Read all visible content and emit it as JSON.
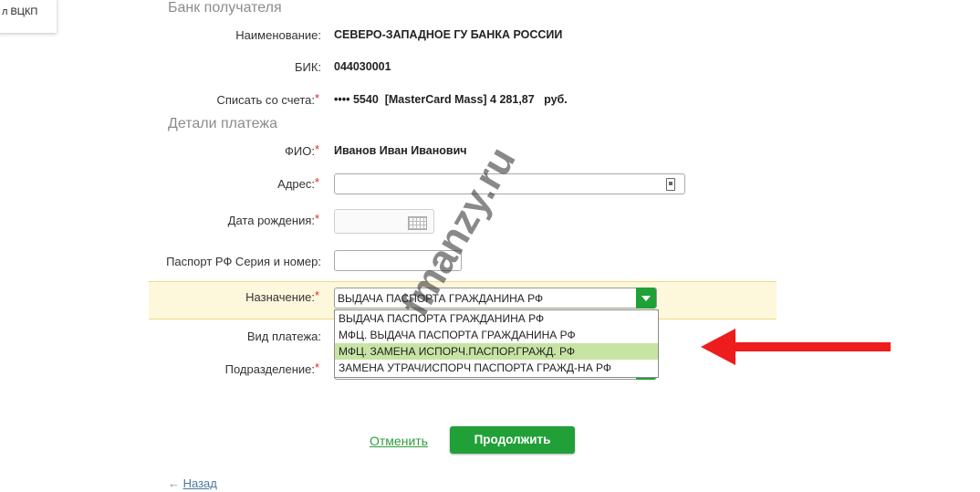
{
  "side_card": {
    "text": "л ВЦКП"
  },
  "bank_section": {
    "title": "Банк получателя",
    "name_label": "Наименование:",
    "name_value": "СЕВЕРО-ЗАПАДНОЕ ГУ БАНКА РОССИИ",
    "bik_label": "БИК:",
    "bik_value": "044030001",
    "account_label": "Списать со счета:",
    "account_value": "•••• 5540  [MasterCard Mass] 4 281,87   руб."
  },
  "payment_section": {
    "title": "Детали платежа",
    "fio_label": "ФИО:",
    "fio_value": "Иванов Иван Иванович",
    "address_label": "Адрес:",
    "address_value": "",
    "birthdate_label": "Дата рождения:",
    "birthdate_value": "",
    "passport_label": "Паспорт РФ Серия и номер:",
    "passport_value": "",
    "purpose_label": "Назначение:",
    "purpose_selected": "ВЫДАЧА ПАСПОРТА ГРАЖДАНИНА РФ",
    "purpose_options": [
      "ВЫДАЧА ПАСПОРТА ГРАЖДАНИНА РФ",
      "МФЦ. ВЫДАЧА ПАСПОРТА ГРАЖДАНИНА РФ",
      "МФЦ. ЗАМЕНА ИСПОРЧ.ПАСПОР.ГРАЖД. РФ",
      "ЗАМЕНА УТРАЧ/ИСПОРЧ ПАСПОРТА ГРАЖД-НА РФ"
    ],
    "purpose_highlighted_index": 2,
    "payment_type_label": "Вид платежа:",
    "division_label": "Подразделение:",
    "required_mark": "*"
  },
  "actions": {
    "cancel_label": "Отменить",
    "continue_label": "Продолжить",
    "back_arrow": "←",
    "back_label": "Назад"
  },
  "watermark": "fmanzy.ru",
  "colors": {
    "accent_green": "#21a038",
    "highlight_row": "#fdf8dc",
    "selected_option": "#c7e4a4",
    "required": "#e3262f",
    "annotation_arrow": "#ee1c1c"
  }
}
